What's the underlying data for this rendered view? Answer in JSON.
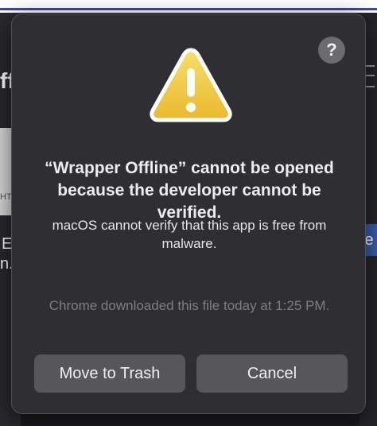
{
  "background": {
    "left_fragments": [
      "ff",
      "HT",
      "E",
      "n.l"
    ],
    "right_fragment": "e"
  },
  "dialog": {
    "help_label": "?",
    "icon": "warning-triangle-icon",
    "title": "“Wrapper Offline” cannot be opened because the developer cannot be verified.",
    "message": "macOS cannot verify that this app is free from malware.",
    "note": "Chrome downloaded this file today at 1:25 PM.",
    "buttons": {
      "move_to_trash": "Move to Trash",
      "cancel": "Cancel"
    }
  },
  "colors": {
    "dialog_bg": "#2f2f33",
    "button_bg": "#56565b",
    "warning_yellow": "#f3cf4a",
    "warning_border": "#ffffff"
  }
}
